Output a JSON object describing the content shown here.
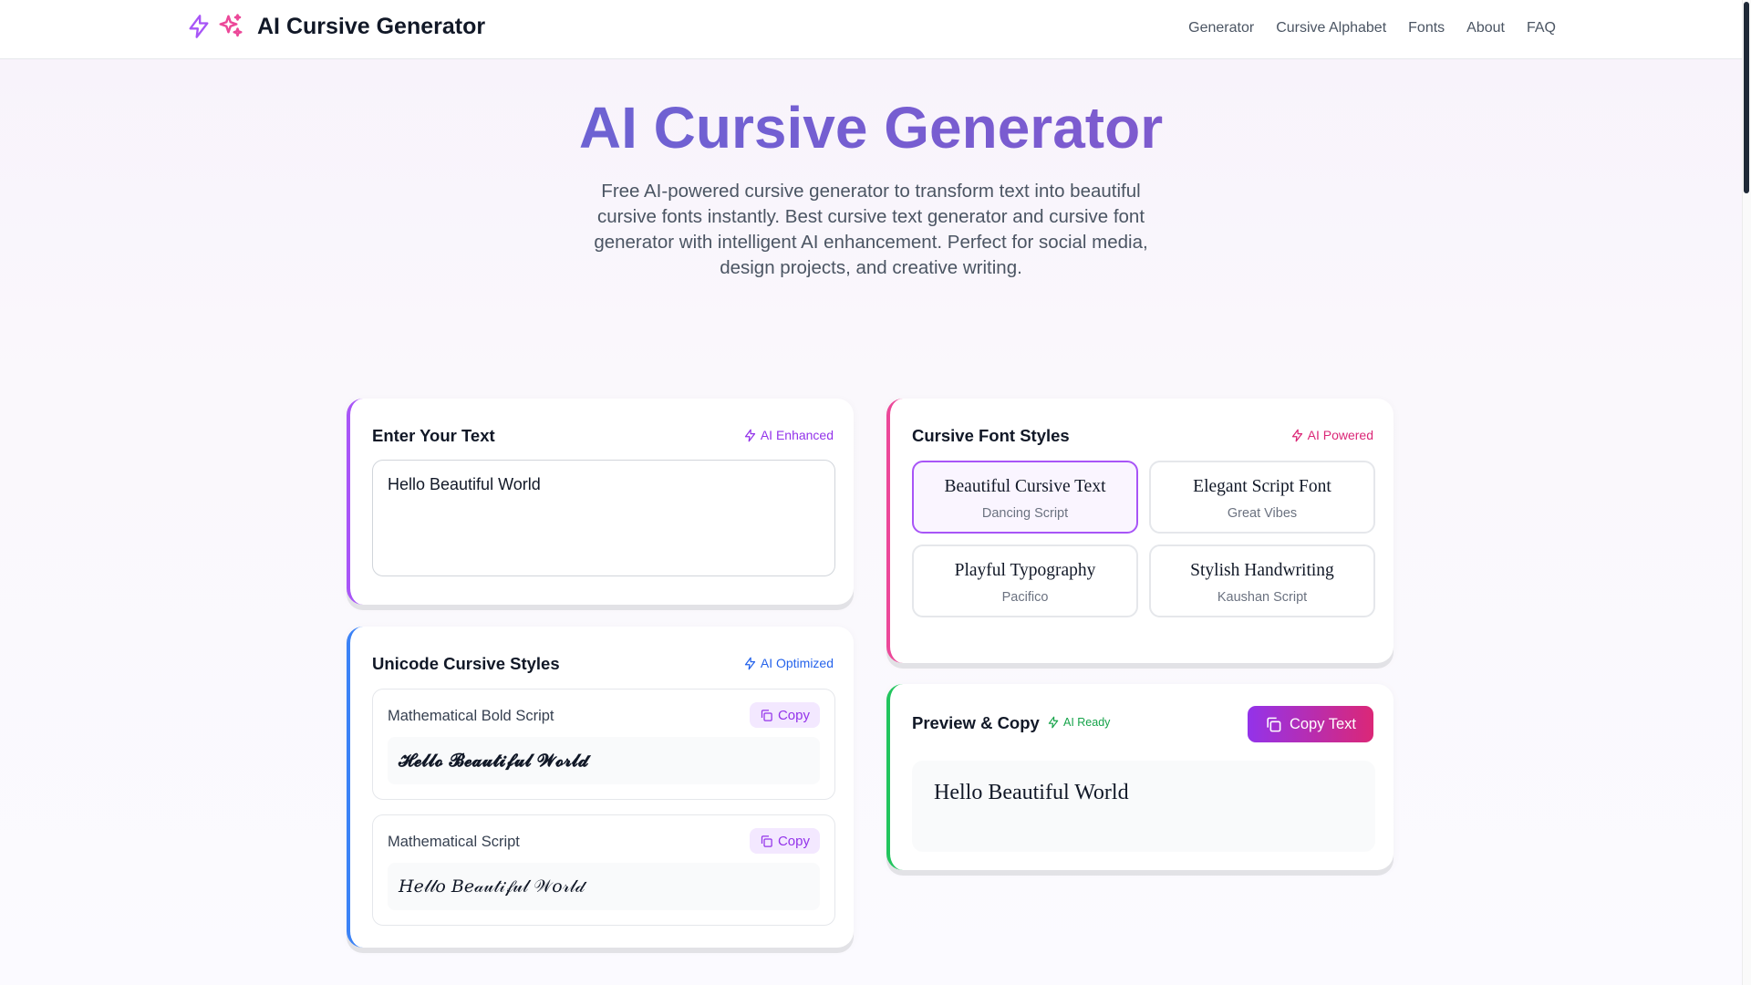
{
  "header": {
    "logo_text": "AI Cursive Generator",
    "nav": [
      "Generator",
      "Cursive Alphabet",
      "Fonts",
      "About",
      "FAQ"
    ]
  },
  "hero": {
    "title": "AI Cursive Generator",
    "subtitle": "Free AI-powered cursive generator to transform text into beautiful cursive fonts instantly. Best cursive text generator and cursive font generator with intelligent AI enhancement. Perfect for social media, design projects, and creative writing."
  },
  "input_card": {
    "title": "Enter Your Text",
    "badge": "AI Enhanced",
    "value": "Hello Beautiful World"
  },
  "unicode_card": {
    "title": "Unicode Cursive Styles",
    "badge": "AI Optimized",
    "styles": [
      {
        "name": "Mathematical Bold Script",
        "copy_label": "Copy",
        "output": "𝓗𝓮𝓵𝓵𝓸 𝓑𝓮𝓪𝓾𝓽𝓲𝓯𝓾𝓵 𝓦𝓸𝓻𝓵𝓭"
      },
      {
        "name": "Mathematical Script",
        "copy_label": "Copy",
        "output": "𝐻𝑒𝓁𝓁𝑜 𝐵𝑒𝒶𝓊𝓉𝒾𝒻𝓊𝓁 𝒲𝑜𝓇𝓁𝒹"
      }
    ]
  },
  "fonts_card": {
    "title": "Cursive Font Styles",
    "badge": "AI Powered",
    "options": [
      {
        "sample": "Beautiful Cursive Text",
        "font": "Dancing Script",
        "selected": true
      },
      {
        "sample": "Elegant Script Font",
        "font": "Great Vibes",
        "selected": false
      },
      {
        "sample": "Playful Typography",
        "font": "Pacifico",
        "selected": false
      },
      {
        "sample": "Stylish Handwriting",
        "font": "Kaushan Script",
        "selected": false
      }
    ]
  },
  "preview_card": {
    "title": "Preview & Copy",
    "badge": "AI Ready",
    "copy_label": "Copy Text",
    "text": "Hello Beautiful World"
  },
  "colors": {
    "accent_purple": "#a855f7",
    "accent_pink": "#ec4899",
    "accent_blue": "#3b82f6",
    "accent_green": "#22c55e"
  }
}
